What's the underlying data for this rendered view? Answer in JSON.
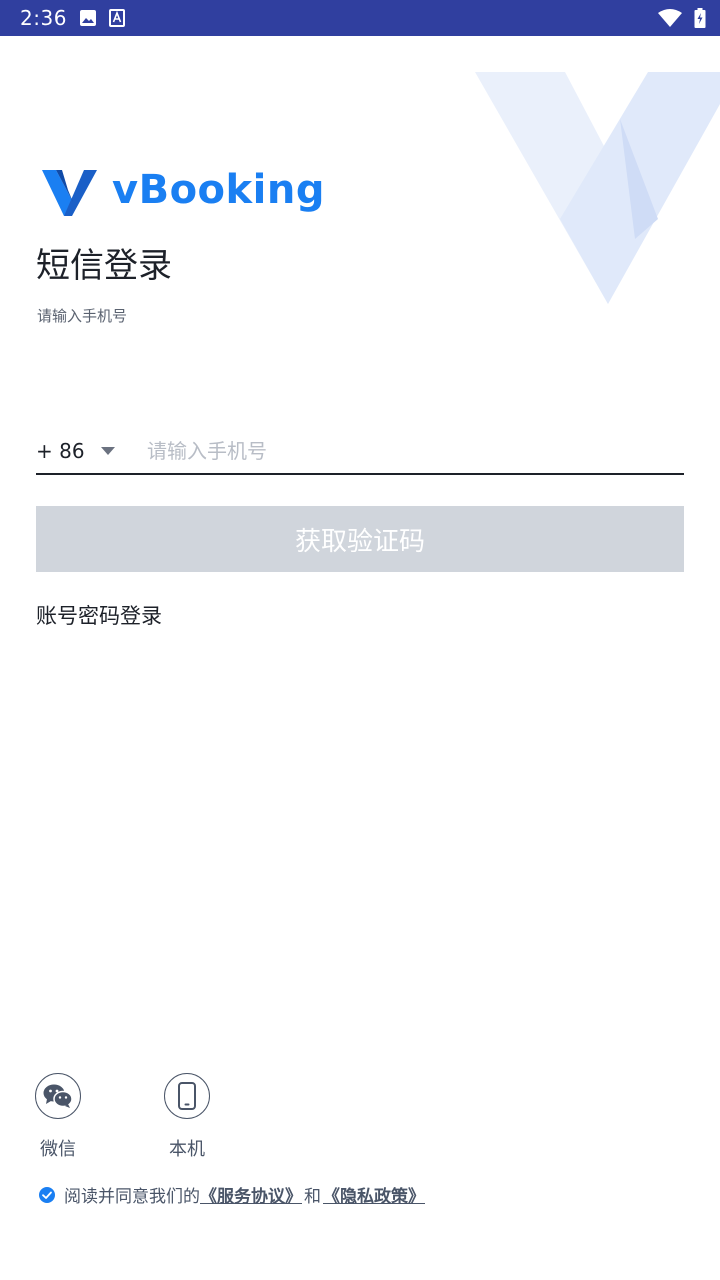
{
  "status_bar": {
    "time": "2:36"
  },
  "logo": {
    "text": "vBooking"
  },
  "title": "短信登录",
  "subtitle": "请输入手机号",
  "phone": {
    "country_code": "+ 86",
    "placeholder": "请输入手机号",
    "value": ""
  },
  "get_code_label": "获取验证码",
  "password_login_label": "账号密码登录",
  "login_options": [
    {
      "label": "微信",
      "icon": "wechat-icon"
    },
    {
      "label": "本机",
      "icon": "phone-icon"
    }
  ],
  "agreement": {
    "prefix": "阅读并同意我们的",
    "service_link": "《服务协议》",
    "and": "和",
    "privacy_link": "《隐私政策》",
    "checked": true
  },
  "colors": {
    "status_bar": "#303f9f",
    "brand": "#1a7ff2",
    "button_disabled": "#d0d5dc"
  }
}
